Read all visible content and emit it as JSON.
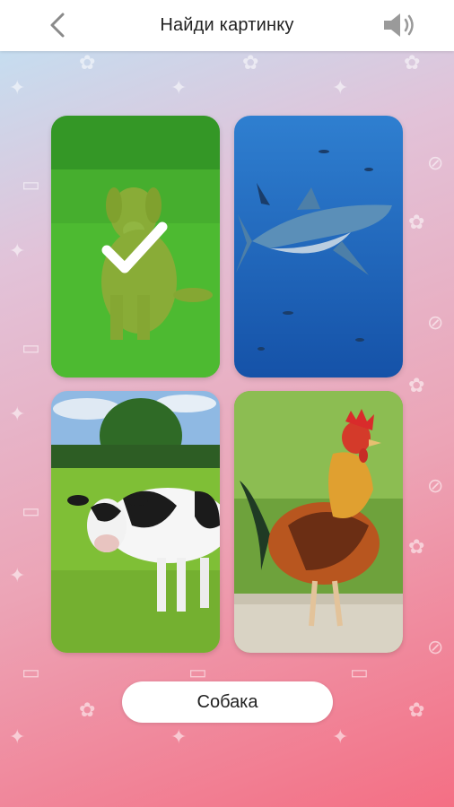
{
  "header": {
    "title": "Найди картинку",
    "back_icon": "chevron-left-icon",
    "sound_icon": "speaker-icon"
  },
  "cards": [
    {
      "subject": "dog",
      "selected": true,
      "state_icon": "checkmark-icon"
    },
    {
      "subject": "shark",
      "selected": false
    },
    {
      "subject": "cow",
      "selected": false
    },
    {
      "subject": "rooster",
      "selected": false
    }
  ],
  "answer": {
    "label": "Собака"
  },
  "colors": {
    "gradient_top": "#bfe3f5",
    "gradient_bottom": "#f46f84",
    "selected_overlay": "#3cb521",
    "check": "#ffffff"
  }
}
